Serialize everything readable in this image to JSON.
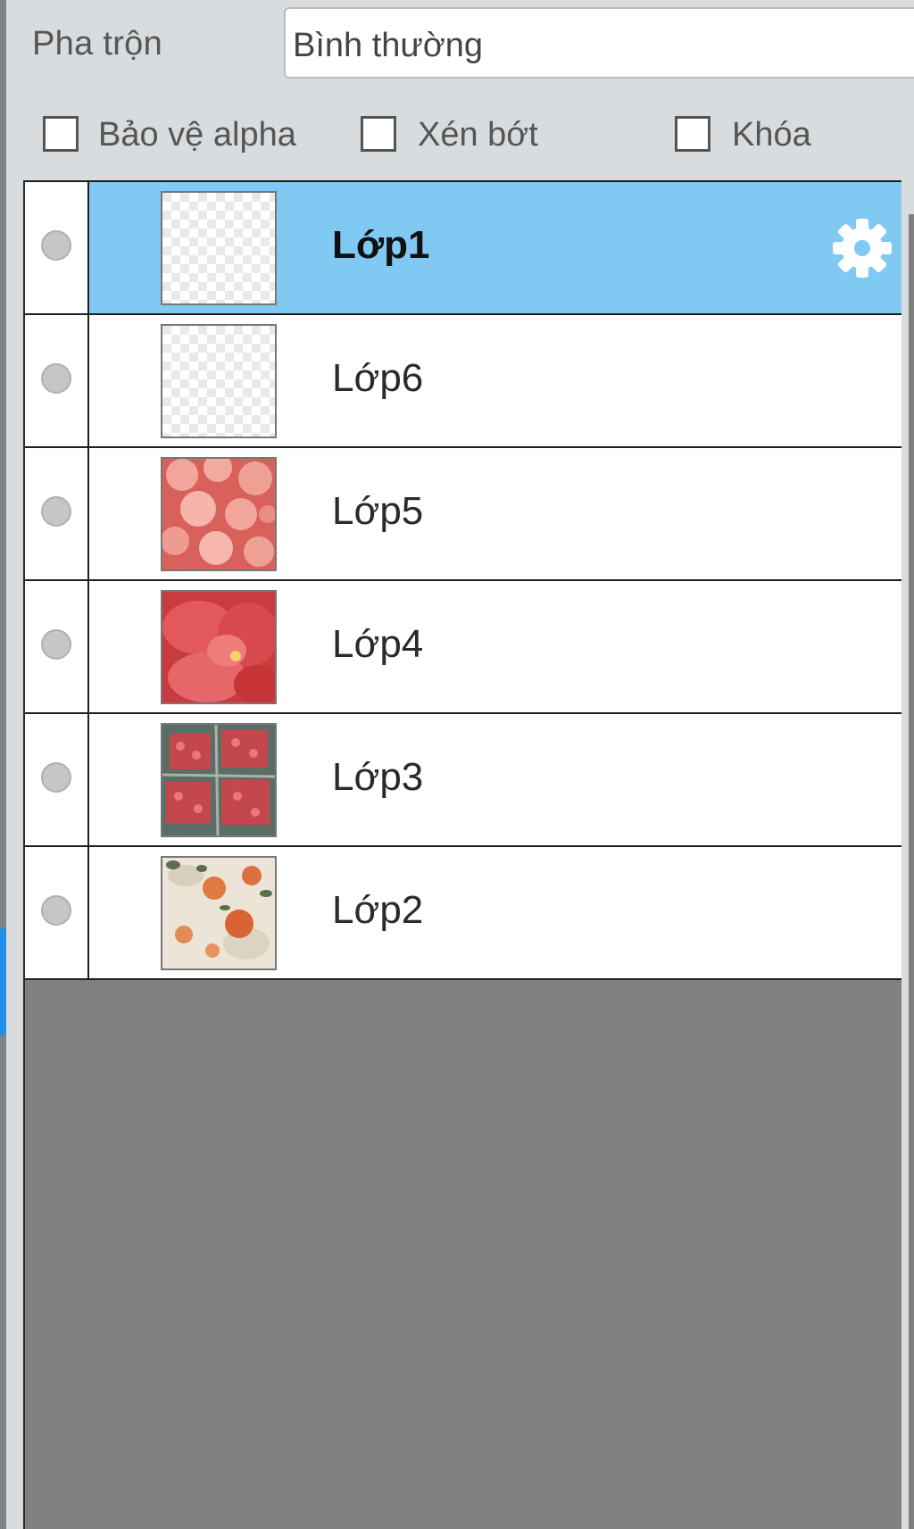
{
  "blend": {
    "label": "Pha trộn",
    "value": "Bình thường"
  },
  "options": [
    {
      "label": "Bảo vệ alpha",
      "checked": false
    },
    {
      "label": "Xén bớt",
      "checked": false
    },
    {
      "label": "Khóa",
      "checked": false
    }
  ],
  "layers": [
    {
      "name": "Lớp1",
      "selected": true,
      "thumb": "transparent-thumbnail",
      "settings_icon": "gear-icon"
    },
    {
      "name": "Lớp6",
      "selected": false,
      "thumb": "transparent-thumbnail"
    },
    {
      "name": "Lớp5",
      "selected": false,
      "thumb": "pink-peonies-thumbnail"
    },
    {
      "name": "Lớp4",
      "selected": false,
      "thumb": "red-flower-thumbnail"
    },
    {
      "name": "Lớp3",
      "selected": false,
      "thumb": "strawberry-crates-thumbnail"
    },
    {
      "name": "Lớp2",
      "selected": false,
      "thumb": "orange-roses-thumbnail"
    }
  ],
  "colors": {
    "selected_row": "#80c9f2",
    "empty_area": "#808080",
    "panel_bg": "#d9dcdf"
  }
}
